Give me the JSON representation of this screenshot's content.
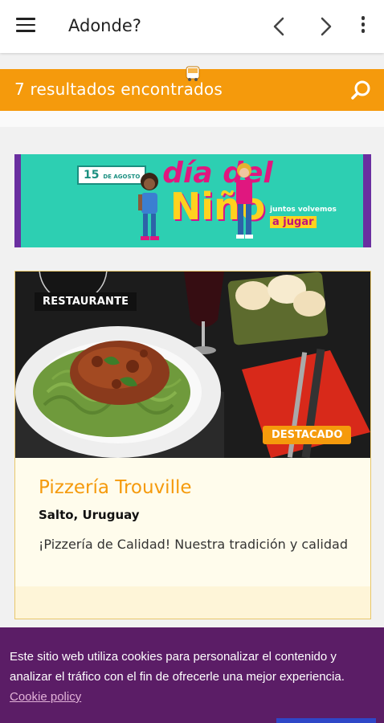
{
  "app": {
    "title": "Adonde?"
  },
  "results": {
    "text": "7 resultados encontrados"
  },
  "banner": {
    "date_number": "15",
    "date_small": "DE AGOSTO",
    "title_line1": "día del",
    "title_line2": "Niño",
    "tagline": "juntos volvemos",
    "tagline_highlight": "a jugar"
  },
  "listing": {
    "category": "RESTAURANTE",
    "featured": "DESTACADO",
    "name": "Pizzería Trouville",
    "location": "Salto, Uruguay",
    "description": "¡Pizzería de Calidad! Nuestra tradición y calidad"
  },
  "cookies": {
    "message": "Este sitio web utiliza cookies para personalizar el contenido y analizar el tráfico con el fin de ofrecerle una mejor experiencia.",
    "link_label": "Cookie policy"
  },
  "colors": {
    "accent": "#f59a0c",
    "cookie_bg": "#5b1d66",
    "banner_bg": "#2dcfb2"
  }
}
